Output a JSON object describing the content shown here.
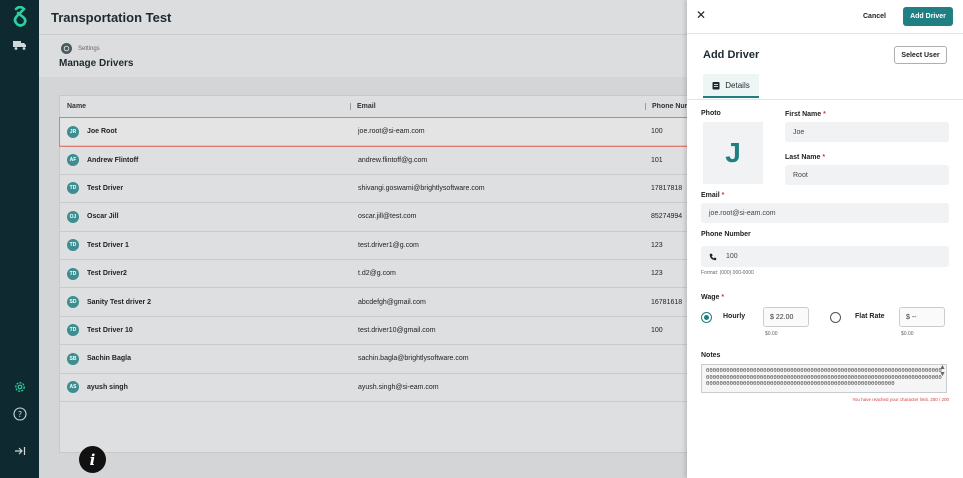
{
  "app": {
    "title": "Transportation Test"
  },
  "breadcrumb": {
    "parent": "Settings",
    "page_title": "Manage Drivers"
  },
  "table": {
    "columns": [
      "Name",
      "Email",
      "Phone Nur"
    ],
    "rows": [
      {
        "initials": "JR",
        "name": "Joe Root",
        "email": "joe.root@si-eam.com",
        "phone": "100"
      },
      {
        "initials": "AF",
        "name": "Andrew Flintoff",
        "email": "andrew.flintoff@g.com",
        "phone": "101"
      },
      {
        "initials": "TD",
        "name": "Test Driver",
        "email": "shivangi.goswami@brightlysoftware.com",
        "phone": "17817818"
      },
      {
        "initials": "OJ",
        "name": "Oscar Jill",
        "email": "oscar.jill@test.com",
        "phone": "85274994"
      },
      {
        "initials": "TD",
        "name": "Test Driver 1",
        "email": "test.driver1@g.com",
        "phone": "123"
      },
      {
        "initials": "TD",
        "name": "Test Driver2",
        "email": "t.d2@g.com",
        "phone": "123"
      },
      {
        "initials": "SD",
        "name": "Sanity Test driver 2",
        "email": "abcdefgh@gmail.com",
        "phone": "16781618"
      },
      {
        "initials": "TD",
        "name": "Test Driver 10",
        "email": "test.driver10@gmail.com",
        "phone": "100"
      },
      {
        "initials": "SB",
        "name": "Sachin Bagla",
        "email": "sachin.bagla@brightlysoftware.com",
        "phone": ""
      },
      {
        "initials": "AS",
        "name": "ayush singh",
        "email": "ayush.singh@si-eam.com",
        "phone": ""
      }
    ]
  },
  "drawer": {
    "cancel_label": "Cancel",
    "add_driver_label": "Add Driver",
    "title": "Add Driver",
    "select_user_label": "Select User",
    "tab_details": "Details",
    "photo_label": "Photo",
    "photo_initial": "J",
    "first_name_label": "First Name",
    "first_name_value": "Joe",
    "last_name_label": "Last Name",
    "last_name_value": "Root",
    "required_mark": "*",
    "email_label": "Email",
    "email_value": "joe.root@si-eam.com",
    "phone_label": "Phone Number",
    "phone_value": "100",
    "phone_format": "Format: (000) 000-0000",
    "wage_label": "Wage",
    "hourly_label": "Hourly",
    "hourly_value": "$  22.00",
    "hourly_sub": "$0.00",
    "flat_rate_label": "Flat Rate",
    "flat_rate_value": "$  --",
    "flat_rate_sub": "$0.00",
    "notes_label": "Notes",
    "notes_value": "0000000000000000000000000000000000000000000000000000000000000000000000000000000000000000000000000000000000000000000000000000000000000000000000000000000000000000000000000000000000000000000000000000",
    "char_limit_msg": "You have reached your character limit. 200 / 200"
  }
}
